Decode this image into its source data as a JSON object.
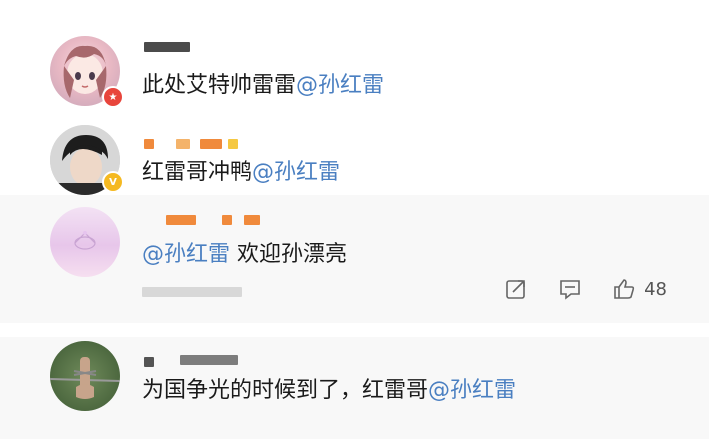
{
  "comments": [
    {
      "avatar": "anime-girl-avatar",
      "badge": "red-star-badge",
      "text": "此处艾特帅雷雷",
      "mention": "@孙红雷"
    },
    {
      "avatar": "young-man-avatar",
      "badge": "gold-verified-v-badge",
      "badge_text": "V",
      "text": "红雷哥冲鸭",
      "mention": "@孙红雷"
    },
    {
      "avatar": "pink-sky-avatar",
      "mention": "@孙红雷",
      "text": " 欢迎孙漂亮",
      "actions": {
        "share_icon": "share-icon",
        "reply_icon": "comment-icon",
        "like_icon": "thumbs-up-icon",
        "like_count": "48"
      }
    },
    {
      "avatar": "barbed-wire-avatar",
      "text": "为国争光的时候到了，红雷哥",
      "mention": "@孙红雷"
    }
  ],
  "colors": {
    "mention": "#4a7fc1",
    "redacted_orange": "#f08a3c",
    "redacted_gray": "#2b2b2b",
    "highlight_bg": "#f8f8f8"
  }
}
